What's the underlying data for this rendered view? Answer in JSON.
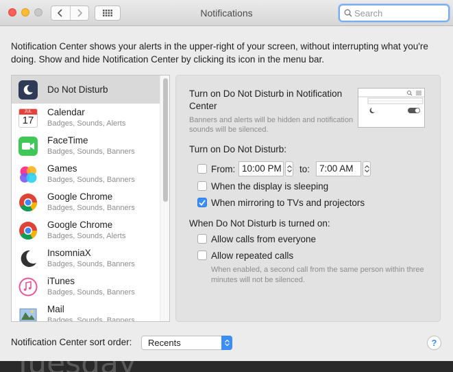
{
  "window": {
    "title": "Notifications"
  },
  "toolbar": {
    "back_icon": "chevron-left-icon",
    "forward_icon": "chevron-right-icon",
    "show_all_icon": "grid-icon"
  },
  "search": {
    "placeholder": "Search",
    "value": ""
  },
  "description": "Notification Center shows your alerts in the upper-right of your screen, without interrupting what you're doing. Show and hide Notification Center by clicking its icon in the menu bar.",
  "apps": [
    {
      "name": "Do Not Disturb",
      "subtitle": "",
      "icon": "moon-icon",
      "selected": true
    },
    {
      "name": "Calendar",
      "subtitle": "Badges, Sounds, Alerts",
      "icon": "calendar-icon",
      "calendar_month": "JUL",
      "calendar_day": "17"
    },
    {
      "name": "FaceTime",
      "subtitle": "Badges, Sounds, Banners",
      "icon": "facetime-icon"
    },
    {
      "name": "Games",
      "subtitle": "Badges, Sounds, Banners",
      "icon": "game-center-icon"
    },
    {
      "name": "Google Chrome",
      "subtitle": "Badges, Sounds, Banners",
      "icon": "chrome-icon"
    },
    {
      "name": "Google Chrome",
      "subtitle": "Badges, Sounds, Alerts",
      "icon": "chrome-icon"
    },
    {
      "name": "InsomniaX",
      "subtitle": "Badges, Sounds, Banners",
      "icon": "crescent-moon-icon"
    },
    {
      "name": "iTunes",
      "subtitle": "Badges, Sounds, Banners",
      "icon": "itunes-icon"
    },
    {
      "name": "Mail",
      "subtitle": "Badges, Sounds, Banners",
      "icon": "mail-icon"
    }
  ],
  "dnd": {
    "heading": "Turn on Do Not Disturb in Notification Center",
    "subtext": "Banners and alerts will be hidden and notification sounds will be silenced.",
    "preview_icon": "notification-center-preview-icon",
    "schedule_heading": "Turn on Do Not Disturb:",
    "from_label": "From:",
    "from_checked": false,
    "from_time": "10:00 PM",
    "to_label": "to:",
    "to_time": "7:00 AM",
    "display_sleeping_label": "When the display is sleeping",
    "display_sleeping_checked": false,
    "mirroring_label": "When mirroring to TVs and projectors",
    "mirroring_checked": true,
    "turned_on_heading": "When Do Not Disturb is turned on:",
    "allow_calls_label": "Allow calls from everyone",
    "allow_calls_checked": false,
    "repeated_calls_label": "Allow repeated calls",
    "repeated_calls_checked": false,
    "repeated_calls_note": "When enabled, a second call from the same person within three minutes will not be silenced."
  },
  "sort": {
    "label": "Notification Center sort order:",
    "value": "Recents"
  },
  "help": {
    "label": "?"
  },
  "desktop": {
    "text": "Tuesday"
  },
  "colors": {
    "accent": "#3b8ef5",
    "selected_row": "#d9d9d9",
    "panel": "#e2e2e2"
  }
}
